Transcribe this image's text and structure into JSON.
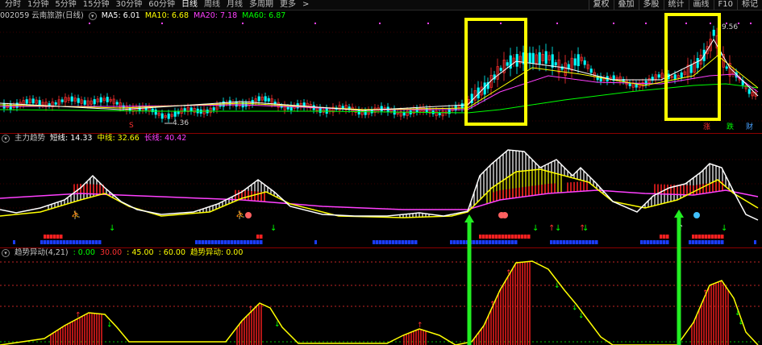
{
  "toolbar": {
    "tabs": [
      "分时",
      "1分钟",
      "5分钟",
      "15分钟",
      "30分钟",
      "60分钟",
      "日线",
      "周线",
      "月线",
      "多周期",
      "更多"
    ],
    "active_tab": "日线",
    "tools": [
      "复权",
      "叠加",
      "多股",
      "统计",
      "画线",
      "F10",
      "标记"
    ],
    "more_arrow": ">"
  },
  "main_panel": {
    "stock": "002059 云南旅游(日线)",
    "ma5_label": "MA5: 6.01",
    "ma10_label": "MA10: 6.68",
    "ma20_label": "MA20: 7.18",
    "ma60_label": "MA60: 6.87",
    "high_label": "9.56",
    "low_label": "4.36",
    "tag_zhang": "涨",
    "tag_die": "跌",
    "tag_cai": "财",
    "tag_s": "S",
    "colors": {
      "ma5": "#ffffff",
      "ma10": "#ffff00",
      "ma20": "#ff40ff",
      "ma60": "#00ff00",
      "up": "#ff3030",
      "down": "#00ffff",
      "box": "#ffff00"
    }
  },
  "trend_panel": {
    "title": "主力趋势",
    "short_label": "短线: 14.33",
    "mid_label": "中线: 32.66",
    "long_label": "长线: 40.42",
    "colors": {
      "short": "#ffffff",
      "mid": "#ffff00",
      "long": "#ff40ff"
    }
  },
  "osc_panel": {
    "title": "趋势异动(4,21)",
    "v0": ": 0.00",
    "v30": "30.00",
    "v45": ": 45.00",
    "v60": ": 60.00",
    "sig_label": "趋势异动: 0.00",
    "colors": {
      "bars": "#ff2020",
      "line": "#ffff00",
      "arrow": "#00ff00"
    }
  },
  "icons": [
    "collapse-circle-icon",
    "arrow-right-icon"
  ]
}
